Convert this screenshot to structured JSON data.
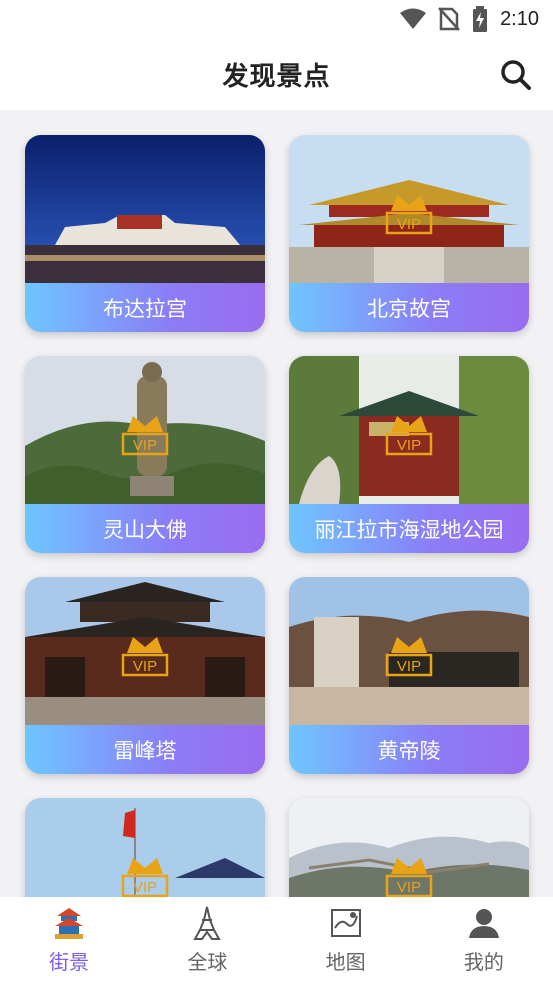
{
  "status_bar": {
    "time": "2:10"
  },
  "header": {
    "title": "发现景点"
  },
  "scenic_spots": [
    {
      "name": "布达拉宫",
      "vip": false
    },
    {
      "name": "北京故宫",
      "vip": true
    },
    {
      "name": "灵山大佛",
      "vip": true
    },
    {
      "name": "丽江拉市海湿地公园",
      "vip": true
    },
    {
      "name": "雷峰塔",
      "vip": true
    },
    {
      "name": "黄帝陵",
      "vip": true
    },
    {
      "name": "",
      "vip": true
    },
    {
      "name": "",
      "vip": true
    }
  ],
  "vip_badge_text": "VIP",
  "tabs": [
    {
      "label": "街景",
      "icon": "temple-icon",
      "active": true
    },
    {
      "label": "全球",
      "icon": "eiffel-tower-icon",
      "active": false
    },
    {
      "label": "地图",
      "icon": "map-icon",
      "active": false
    },
    {
      "label": "我的",
      "icon": "user-icon",
      "active": false
    }
  ],
  "colors": {
    "accent": "#7d5cf2",
    "label_gradient_start": "#6ec6ff",
    "label_gradient_end": "#9a6cf0",
    "vip_gold": "#e8a317"
  }
}
